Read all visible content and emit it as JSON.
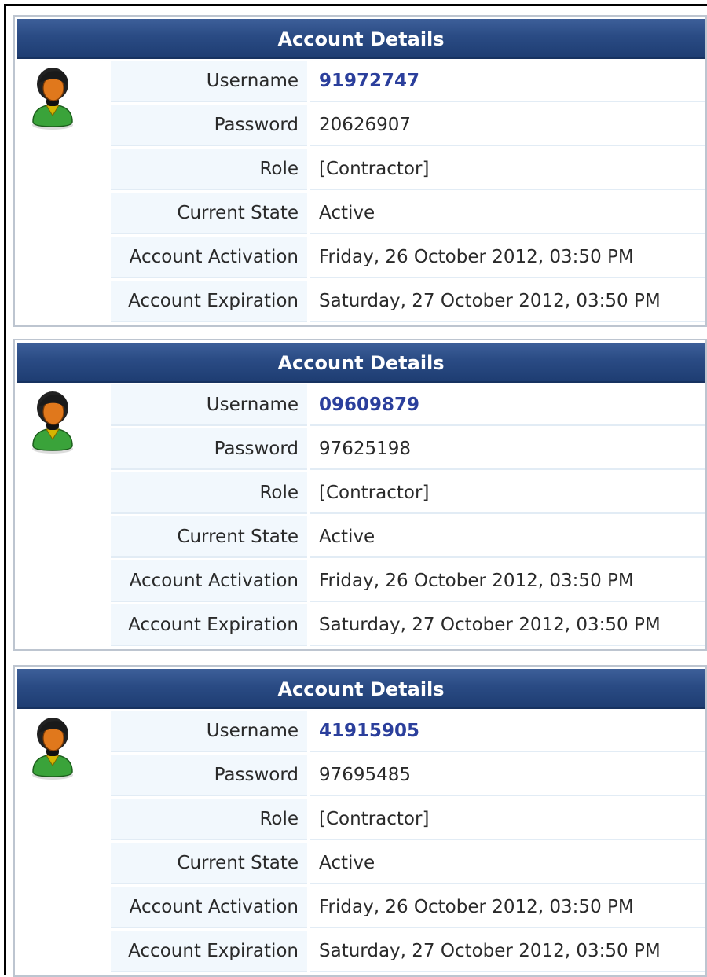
{
  "accounts": [
    {
      "title": "Account Details",
      "fields": [
        {
          "label": "Username",
          "value": "91972747"
        },
        {
          "label": "Password",
          "value": "20626907"
        },
        {
          "label": "Role",
          "value": "[Contractor]"
        },
        {
          "label": "Current State",
          "value": "Active"
        },
        {
          "label": "Account Activation",
          "value": "Friday, 26 October 2012, 03:50 PM"
        },
        {
          "label": "Account Expiration",
          "value": "Saturday, 27 October 2012, 03:50 PM"
        }
      ]
    },
    {
      "title": "Account Details",
      "fields": [
        {
          "label": "Username",
          "value": "09609879"
        },
        {
          "label": "Password",
          "value": "97625198"
        },
        {
          "label": "Role",
          "value": "[Contractor]"
        },
        {
          "label": "Current State",
          "value": "Active"
        },
        {
          "label": "Account Activation",
          "value": "Friday, 26 October 2012, 03:50 PM"
        },
        {
          "label": "Account Expiration",
          "value": "Saturday, 27 October 2012, 03:50 PM"
        }
      ]
    },
    {
      "title": "Account Details",
      "fields": [
        {
          "label": "Username",
          "value": "41915905"
        },
        {
          "label": "Password",
          "value": "97695485"
        },
        {
          "label": "Role",
          "value": "[Contractor]"
        },
        {
          "label": "Current State",
          "value": "Active"
        },
        {
          "label": "Account Activation",
          "value": "Friday, 26 October 2012, 03:50 PM"
        },
        {
          "label": "Account Expiration",
          "value": "Saturday, 27 October 2012, 03:50 PM"
        }
      ]
    }
  ],
  "icons": {
    "avatar": "contractor-user-icon"
  },
  "colors": {
    "header_bg": "#2a4b84",
    "username_text": "#2b3f9c",
    "label_bg": "#f2f8fd",
    "avatar_shirt": "#3aa33a",
    "avatar_face": "#e0781c"
  }
}
